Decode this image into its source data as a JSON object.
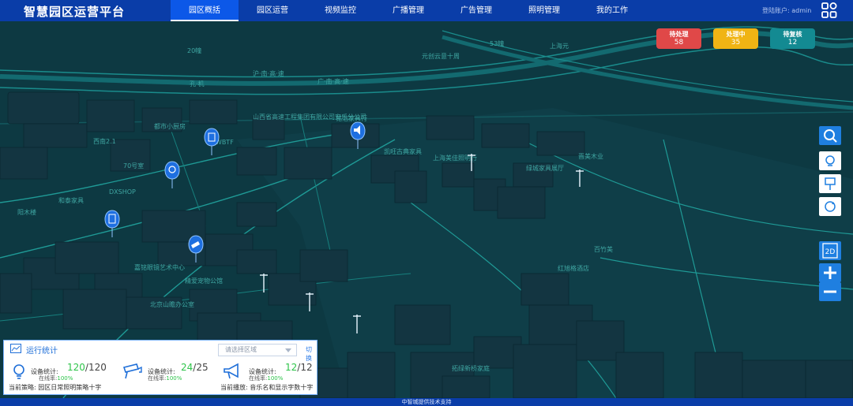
{
  "header": {
    "brand": "智慧园区运营平台",
    "nav": [
      "园区概括",
      "园区运营",
      "视频监控",
      "广播管理",
      "广告管理",
      "照明管理",
      "我的工作"
    ],
    "active_index": 0,
    "account_label": "登陆账户: admin"
  },
  "map_labels": [
    {
      "text": "20幢"
    },
    {
      "text": "53幢"
    },
    {
      "text": "上海元"
    },
    {
      "text": "元创云意十周"
    },
    {
      "text": "沪·南·高·速"
    },
    {
      "text": "广·南·高·速"
    },
    {
      "text": "孔·机"
    },
    {
      "text": "山西省高速工程集团有限公司安乐分公司"
    },
    {
      "text": "铭浩家具行"
    },
    {
      "text": "都市小厨房"
    },
    {
      "text": "WWBTF"
    },
    {
      "text": "西南2.1"
    },
    {
      "text": "70号室"
    },
    {
      "text": "DXSHOP"
    },
    {
      "text": "上海美佳照明行"
    },
    {
      "text": "凯旺古典家具"
    },
    {
      "text": "绿城家具展厅"
    },
    {
      "text": "晋美木业"
    },
    {
      "text": "嘉铭眼镜艺术中心"
    },
    {
      "text": "精爱宠物公馆"
    },
    {
      "text": "北京山瞻办公室"
    },
    {
      "text": "拓绿新桥家庭"
    },
    {
      "text": "红旭格酒店"
    },
    {
      "text": "百竹美"
    },
    {
      "text": "和泰家具"
    },
    {
      "text": "阳木楼"
    }
  ],
  "status_badges": [
    {
      "title": "待处理",
      "count": "58",
      "color": "#e04848"
    },
    {
      "title": "处理中",
      "count": "35",
      "color": "#f0b414"
    },
    {
      "title": "待复核",
      "count": "12",
      "color": "#138a92"
    }
  ],
  "map_tools": {
    "view_mode": "2D"
  },
  "panel": {
    "title": "运行统计",
    "area_placeholder": "请选择区域",
    "switch_label": "切换",
    "stats": [
      {
        "label": "设备统计:",
        "current": "120",
        "total": "/120",
        "rate_label": "在线率:",
        "rate": "100%",
        "icon": "lightbulb-icon"
      },
      {
        "label": "设备统计:",
        "current": "24",
        "total": "/25",
        "rate_label": "在线率:",
        "rate": "100%",
        "icon": "camera-icon"
      },
      {
        "label": "设备统计:",
        "current": "12",
        "total": "/12",
        "rate_label": "在线率:",
        "rate": "100%",
        "icon": "megaphone-icon"
      }
    ],
    "strategy": [
      {
        "label": "当前策略:",
        "value": "园区日常照明策略十字"
      },
      {
        "label": "当前播放:",
        "value": "音乐名和显示字数十字"
      }
    ]
  },
  "footer": {
    "text": "中智城提供技术支持"
  }
}
